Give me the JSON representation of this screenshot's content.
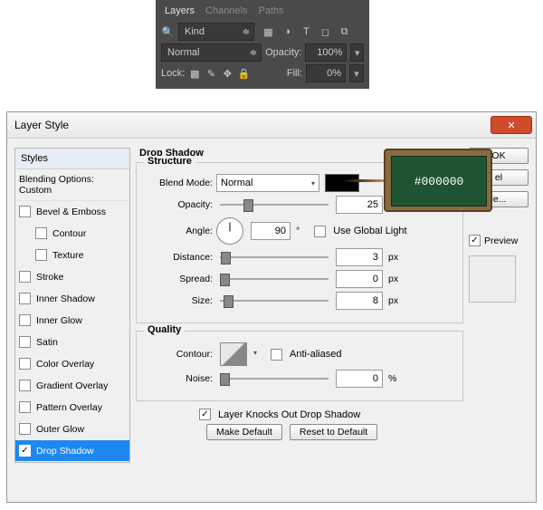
{
  "layers_panel": {
    "tabs": [
      "Layers",
      "Channels",
      "Paths"
    ],
    "filter_kind": "Kind",
    "blend_mode": "Normal",
    "opacity_label": "Opacity:",
    "opacity_value": "100%",
    "lock_label": "Lock:",
    "fill_label": "Fill:",
    "fill_value": "0%"
  },
  "dialog": {
    "title": "Layer Style",
    "styles_list": {
      "head": "Styles",
      "blending": "Blending Options: Custom",
      "items": [
        {
          "label": "Bevel & Emboss",
          "checked": false,
          "indent": false
        },
        {
          "label": "Contour",
          "checked": false,
          "indent": true
        },
        {
          "label": "Texture",
          "checked": false,
          "indent": true
        },
        {
          "label": "Stroke",
          "checked": false,
          "indent": false
        },
        {
          "label": "Inner Shadow",
          "checked": false,
          "indent": false
        },
        {
          "label": "Inner Glow",
          "checked": false,
          "indent": false
        },
        {
          "label": "Satin",
          "checked": false,
          "indent": false
        },
        {
          "label": "Color Overlay",
          "checked": false,
          "indent": false
        },
        {
          "label": "Gradient Overlay",
          "checked": false,
          "indent": false
        },
        {
          "label": "Pattern Overlay",
          "checked": false,
          "indent": false
        },
        {
          "label": "Outer Glow",
          "checked": false,
          "indent": false
        },
        {
          "label": "Drop Shadow",
          "checked": true,
          "indent": false,
          "selected": true
        }
      ]
    },
    "settings": {
      "title": "Drop Shadow",
      "structure_label": "Structure",
      "blend_mode_label": "Blend Mode:",
      "blend_mode_value": "Normal",
      "color": "#000000",
      "opacity_label": "Opacity:",
      "opacity_value": "25",
      "opacity_unit": "%",
      "angle_label": "Angle:",
      "angle_value": "90",
      "angle_unit": "°",
      "use_global": "Use Global Light",
      "distance_label": "Distance:",
      "distance_value": "3",
      "distance_unit": "px",
      "spread_label": "Spread:",
      "spread_value": "0",
      "spread_unit": "px",
      "size_label": "Size:",
      "size_value": "8",
      "size_unit": "px",
      "quality_label": "Quality",
      "contour_label": "Contour:",
      "antialiased": "Anti-aliased",
      "noise_label": "Noise:",
      "noise_value": "0",
      "noise_unit": "%",
      "knockout": "Layer Knocks Out Drop Shadow",
      "make_default": "Make Default",
      "reset_default": "Reset to Default"
    },
    "right": {
      "ok": "OK",
      "cancel": "el",
      "new_style": "le...",
      "preview": "Preview"
    }
  },
  "chalk_label": "#000000"
}
